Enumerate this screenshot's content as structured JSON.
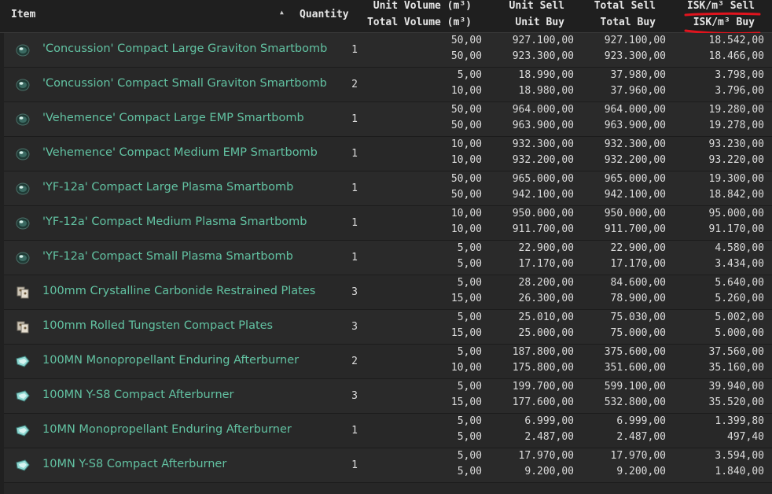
{
  "header": {
    "item": "Item",
    "quantity": "Quantity",
    "volume_line1": "Unit Volume (m³)",
    "volume_line2": "Total Volume (m³)",
    "sell_line1": "Unit Sell",
    "sell_line2": "Unit Buy",
    "total_line1": "Total Sell",
    "total_line2": "Total Buy",
    "isk_line1": "ISK/m³ Sell",
    "isk_line2": "ISK/m³ Buy",
    "sort_indicator": "▲"
  },
  "accent_colors": {
    "item_name": "#62c2a2",
    "annotation": "#e0141e"
  },
  "rows": [
    {
      "icon": "smartbomb-icon",
      "name": "'Concussion' Compact Large Graviton Smartbomb",
      "qty": "1",
      "v1": "50,00",
      "v2": "50,00",
      "u1": "927.100,00",
      "u2": "923.300,00",
      "t1": "927.100,00",
      "t2": "923.300,00",
      "i1": "18.542,00",
      "i2": "18.466,00"
    },
    {
      "icon": "smartbomb-icon",
      "name": "'Concussion' Compact Small Graviton Smartbomb",
      "qty": "2",
      "v1": "5,00",
      "v2": "10,00",
      "u1": "18.990,00",
      "u2": "18.980,00",
      "t1": "37.980,00",
      "t2": "37.960,00",
      "i1": "3.798,00",
      "i2": "3.796,00"
    },
    {
      "icon": "smartbomb-icon",
      "name": "'Vehemence' Compact Large EMP Smartbomb",
      "qty": "1",
      "v1": "50,00",
      "v2": "50,00",
      "u1": "964.000,00",
      "u2": "963.900,00",
      "t1": "964.000,00",
      "t2": "963.900,00",
      "i1": "19.280,00",
      "i2": "19.278,00"
    },
    {
      "icon": "smartbomb-icon",
      "name": "'Vehemence' Compact Medium EMP Smartbomb",
      "qty": "1",
      "v1": "10,00",
      "v2": "10,00",
      "u1": "932.300,00",
      "u2": "932.200,00",
      "t1": "932.300,00",
      "t2": "932.200,00",
      "i1": "93.230,00",
      "i2": "93.220,00"
    },
    {
      "icon": "smartbomb-icon",
      "name": "'YF-12a' Compact Large Plasma Smartbomb",
      "qty": "1",
      "v1": "50,00",
      "v2": "50,00",
      "u1": "965.000,00",
      "u2": "942.100,00",
      "t1": "965.000,00",
      "t2": "942.100,00",
      "i1": "19.300,00",
      "i2": "18.842,00"
    },
    {
      "icon": "smartbomb-icon",
      "name": "'YF-12a' Compact Medium Plasma Smartbomb",
      "qty": "1",
      "v1": "10,00",
      "v2": "10,00",
      "u1": "950.000,00",
      "u2": "911.700,00",
      "t1": "950.000,00",
      "t2": "911.700,00",
      "i1": "95.000,00",
      "i2": "91.170,00"
    },
    {
      "icon": "smartbomb-icon",
      "name": "'YF-12a' Compact Small Plasma Smartbomb",
      "qty": "1",
      "v1": "5,00",
      "v2": "5,00",
      "u1": "22.900,00",
      "u2": "17.170,00",
      "t1": "22.900,00",
      "t2": "17.170,00",
      "i1": "4.580,00",
      "i2": "3.434,00"
    },
    {
      "icon": "armor-plate-icon",
      "name": "100mm Crystalline Carbonide Restrained Plates",
      "qty": "3",
      "v1": "5,00",
      "v2": "15,00",
      "u1": "28.200,00",
      "u2": "26.300,00",
      "t1": "84.600,00",
      "t2": "78.900,00",
      "i1": "5.640,00",
      "i2": "5.260,00"
    },
    {
      "icon": "armor-plate-icon",
      "name": "100mm Rolled Tungsten Compact Plates",
      "qty": "3",
      "v1": "5,00",
      "v2": "15,00",
      "u1": "25.010,00",
      "u2": "25.000,00",
      "t1": "75.030,00",
      "t2": "75.000,00",
      "i1": "5.002,00",
      "i2": "5.000,00"
    },
    {
      "icon": "afterburner-icon",
      "name": "100MN Monopropellant Enduring Afterburner",
      "qty": "2",
      "v1": "5,00",
      "v2": "10,00",
      "u1": "187.800,00",
      "u2": "175.800,00",
      "t1": "375.600,00",
      "t2": "351.600,00",
      "i1": "37.560,00",
      "i2": "35.160,00"
    },
    {
      "icon": "afterburner-icon",
      "name": "100MN Y-S8 Compact Afterburner",
      "qty": "3",
      "v1": "5,00",
      "v2": "15,00",
      "u1": "199.700,00",
      "u2": "177.600,00",
      "t1": "599.100,00",
      "t2": "532.800,00",
      "i1": "39.940,00",
      "i2": "35.520,00"
    },
    {
      "icon": "afterburner-icon",
      "name": "10MN Monopropellant Enduring Afterburner",
      "qty": "1",
      "v1": "5,00",
      "v2": "5,00",
      "u1": "6.999,00",
      "u2": "2.487,00",
      "t1": "6.999,00",
      "t2": "2.487,00",
      "i1": "1.399,80",
      "i2": "497,40"
    },
    {
      "icon": "afterburner-icon",
      "name": "10MN Y-S8 Compact Afterburner",
      "qty": "1",
      "v1": "5,00",
      "v2": "5,00",
      "u1": "17.970,00",
      "u2": "9.200,00",
      "t1": "17.970,00",
      "t2": "9.200,00",
      "i1": "3.594,00",
      "i2": "1.840,00"
    }
  ]
}
